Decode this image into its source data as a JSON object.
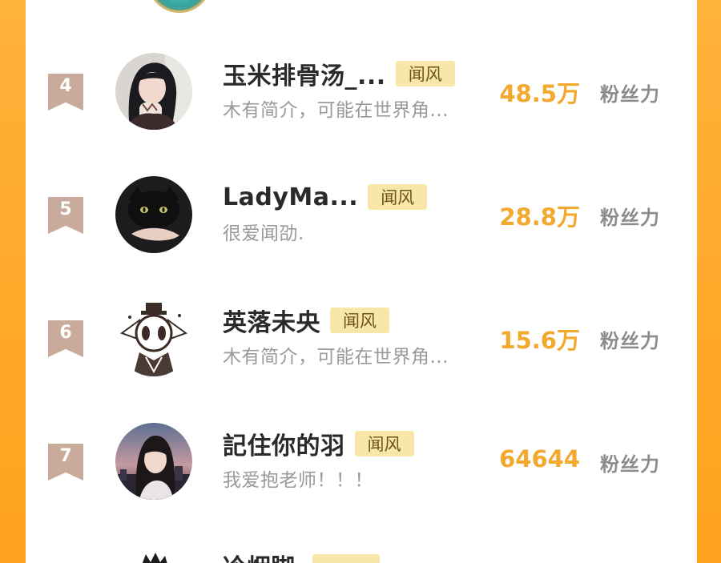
{
  "rows": [
    {
      "rank": "4",
      "name": "玉米排骨汤_...",
      "tag": "闻风",
      "desc": "木有简介，可能在世界角...",
      "count": "48.5万",
      "unit": "粉丝力"
    },
    {
      "rank": "5",
      "name": "LadyMa...",
      "tag": "闻风",
      "desc": "很爱闻劭.",
      "count": "28.8万",
      "unit": "粉丝力"
    },
    {
      "rank": "6",
      "name": "英落未央",
      "tag": "闻风",
      "desc": "木有简介，可能在世界角...",
      "count": "15.6万",
      "unit": "粉丝力"
    },
    {
      "rank": "7",
      "name": "記住你的羽",
      "tag": "闻风",
      "desc": "我爱抱老师！！！",
      "count": "64644",
      "unit": "粉丝力"
    }
  ],
  "next_row": {
    "name": "冷烟脚"
  },
  "colors": {
    "accent": "#f3a82e",
    "tag_bg": "#f8e7a8",
    "rank_badge": "#c9ab9b",
    "frame": "#ffa21d"
  }
}
